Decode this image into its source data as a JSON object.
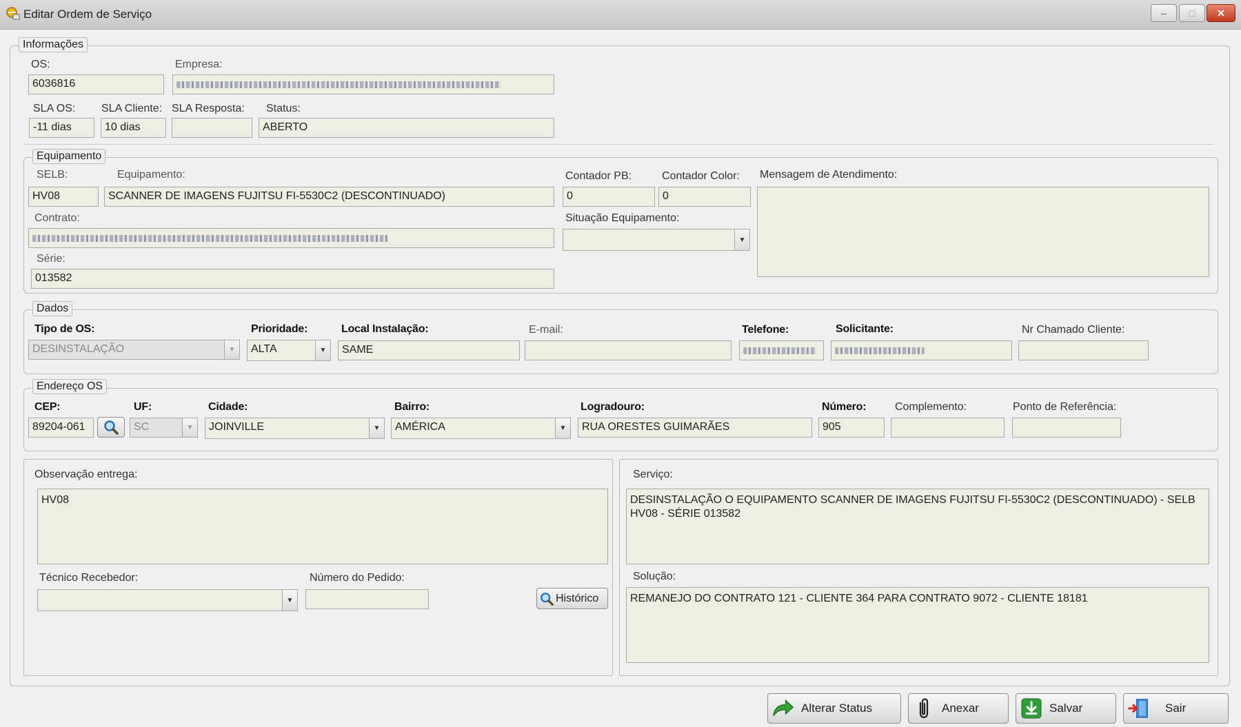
{
  "window": {
    "title": "Editar Ordem de Serviço",
    "minimize": "–",
    "maximize": "□",
    "close": "✕"
  },
  "info": {
    "group": "Informações",
    "os_label": "OS:",
    "os_value": "6036816",
    "empresa_label": "Empresa:",
    "sla_os_label": "SLA OS:",
    "sla_os_value": "-11 dias",
    "sla_cliente_label": "SLA Cliente:",
    "sla_cliente_value": "10 dias",
    "sla_resposta_label": "SLA Resposta:",
    "sla_resposta_value": "",
    "status_label": "Status:",
    "status_value": "ABERTO"
  },
  "equip": {
    "group": "Equipamento",
    "selb_label": "SELB:",
    "selb_value": "HV08",
    "equip_label": "Equipamento:",
    "equip_value": "SCANNER DE IMAGENS FUJITSU FI-5530C2 (DESCONTINUADO)",
    "contador_pb_label": "Contador PB:",
    "contador_pb_value": "0",
    "contador_color_label": "Contador Color:",
    "contador_color_value": "0",
    "mensagem_label": "Mensagem de Atendimento:",
    "contrato_label": "Contrato:",
    "situacao_label": "Situação Equipamento:",
    "situacao_value": "",
    "serie_label": "Série:",
    "serie_value": "013582"
  },
  "dados": {
    "group": "Dados",
    "tipo_label": "Tipo de OS:",
    "tipo_value": "DESINSTALAÇÃO",
    "prioridade_label": "Prioridade:",
    "prioridade_value": "ALTA",
    "local_label": "Local Instalação:",
    "local_value": "SAME",
    "email_label": "E-mail:",
    "email_value": "",
    "telefone_label": "Telefone:",
    "solicitante_label": "Solicitante:",
    "nr_chamado_label": "Nr Chamado Cliente:",
    "nr_chamado_value": ""
  },
  "endereco": {
    "group": "Endereço OS",
    "cep_label": "CEP:",
    "cep_value": "89204-061",
    "uf_label": "UF:",
    "uf_value": "SC",
    "cidade_label": "Cidade:",
    "cidade_value": "JOINVILLE",
    "bairro_label": "Bairro:",
    "bairro_value": "AMÉRICA",
    "logradouro_label": "Logradouro:",
    "logradouro_value": "RUA ORESTES GUIMARÃES",
    "numero_label": "Número:",
    "numero_value": "905",
    "complemento_label": "Complemento:",
    "complemento_value": "",
    "ponto_label": "Ponto de Referência:",
    "ponto_value": ""
  },
  "obs": {
    "label": "Observação entrega:",
    "value": "HV08",
    "tecnico_label": "Técnico Recebedor:",
    "tecnico_value": "",
    "pedido_label": "Número do Pedido:",
    "pedido_value": "",
    "historico_button": "Histórico"
  },
  "servico": {
    "label": "Serviço:",
    "value": "DESINSTALAÇÃO O EQUIPAMENTO SCANNER DE IMAGENS FUJITSU FI-5530C2 (DESCONTINUADO) - SELB HV08 - SÉRIE 013582",
    "solucao_label": "Solução:",
    "solucao_value": "REMANEJO DO CONTRATO 121 - CLIENTE 364 PARA CONTRATO 9072 - CLIENTE 18181"
  },
  "buttons": {
    "alterar": "Alterar Status",
    "anexar": "Anexar",
    "salvar": "Salvar",
    "sair": "Sair"
  },
  "icons": {
    "app": "app-icon",
    "search": "search-icon",
    "arrow": "green-arrow-icon",
    "clip": "paperclip-icon",
    "save": "save-icon",
    "exit": "exit-door-icon"
  },
  "colors": {
    "field_bg": "#efeee2",
    "window_bg": "#f0f0f0",
    "close": "#c2391e",
    "save_green": "#2e9e3a"
  }
}
